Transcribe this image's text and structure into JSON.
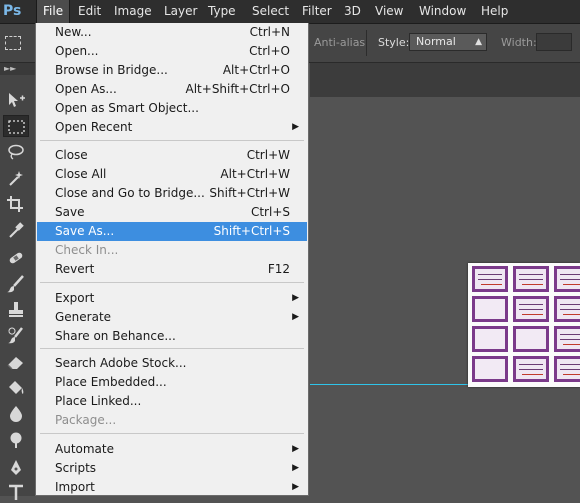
{
  "app": {
    "logo": "Ps"
  },
  "menubar": {
    "items": [
      {
        "label": "File",
        "active": true
      },
      {
        "label": "Edit"
      },
      {
        "label": "Image"
      },
      {
        "label": "Layer"
      },
      {
        "label": "Type"
      },
      {
        "label": "Select"
      },
      {
        "label": "Filter"
      },
      {
        "label": "3D"
      },
      {
        "label": "View"
      },
      {
        "label": "Window"
      },
      {
        "label": "Help"
      }
    ]
  },
  "options": {
    "antialias_label": "Anti-alias",
    "style_label": "Style:",
    "style_value": "Normal",
    "width_label": "Width:"
  },
  "file_menu": {
    "groups": [
      [
        {
          "label": "New...",
          "shortcut": "Ctrl+N"
        },
        {
          "label": "Open...",
          "shortcut": "Ctrl+O"
        },
        {
          "label": "Browse in Bridge...",
          "shortcut": "Alt+Ctrl+O"
        },
        {
          "label": "Open As...",
          "shortcut": "Alt+Shift+Ctrl+O"
        },
        {
          "label": "Open as Smart Object...",
          "shortcut": ""
        },
        {
          "label": "Open Recent",
          "shortcut": "",
          "submenu": true
        }
      ],
      [
        {
          "label": "Close",
          "shortcut": "Ctrl+W"
        },
        {
          "label": "Close All",
          "shortcut": "Alt+Ctrl+W"
        },
        {
          "label": "Close and Go to Bridge...",
          "shortcut": "Shift+Ctrl+W"
        },
        {
          "label": "Save",
          "shortcut": "Ctrl+S"
        },
        {
          "label": "Save As...",
          "shortcut": "Shift+Ctrl+S",
          "highlighted": true
        },
        {
          "label": "Check In...",
          "shortcut": "",
          "disabled": true
        },
        {
          "label": "Revert",
          "shortcut": "F12"
        }
      ],
      [
        {
          "label": "Export",
          "shortcut": "",
          "submenu": true
        },
        {
          "label": "Generate",
          "shortcut": "",
          "submenu": true
        },
        {
          "label": "Share on Behance...",
          "shortcut": ""
        }
      ],
      [
        {
          "label": "Search Adobe Stock...",
          "shortcut": ""
        },
        {
          "label": "Place Embedded...",
          "shortcut": ""
        },
        {
          "label": "Place Linked...",
          "shortcut": ""
        },
        {
          "label": "Package...",
          "shortcut": "",
          "disabled": true
        }
      ],
      [
        {
          "label": "Automate",
          "shortcut": "",
          "submenu": true
        },
        {
          "label": "Scripts",
          "shortcut": "",
          "submenu": true
        },
        {
          "label": "Import",
          "shortcut": "",
          "submenu": true
        }
      ]
    ]
  },
  "toolbar": {
    "tools": [
      "move-tool-icon",
      "marquee-tool-icon",
      "lasso-tool-icon",
      "magic-wand-tool-icon",
      "crop-tool-icon",
      "eyedropper-tool-icon",
      "healing-brush-tool-icon",
      "brush-tool-icon",
      "clone-stamp-tool-icon",
      "history-brush-tool-icon",
      "eraser-tool-icon",
      "paint-bucket-tool-icon",
      "blur-tool-icon",
      "dodge-tool-icon",
      "pen-tool-icon",
      "type-tool-icon"
    ],
    "selected": "marquee-tool-icon"
  },
  "colors": {
    "menu_highlight": "#3d8ee0",
    "guide": "#2fc4ea",
    "card_border": "#7b3a8a"
  }
}
